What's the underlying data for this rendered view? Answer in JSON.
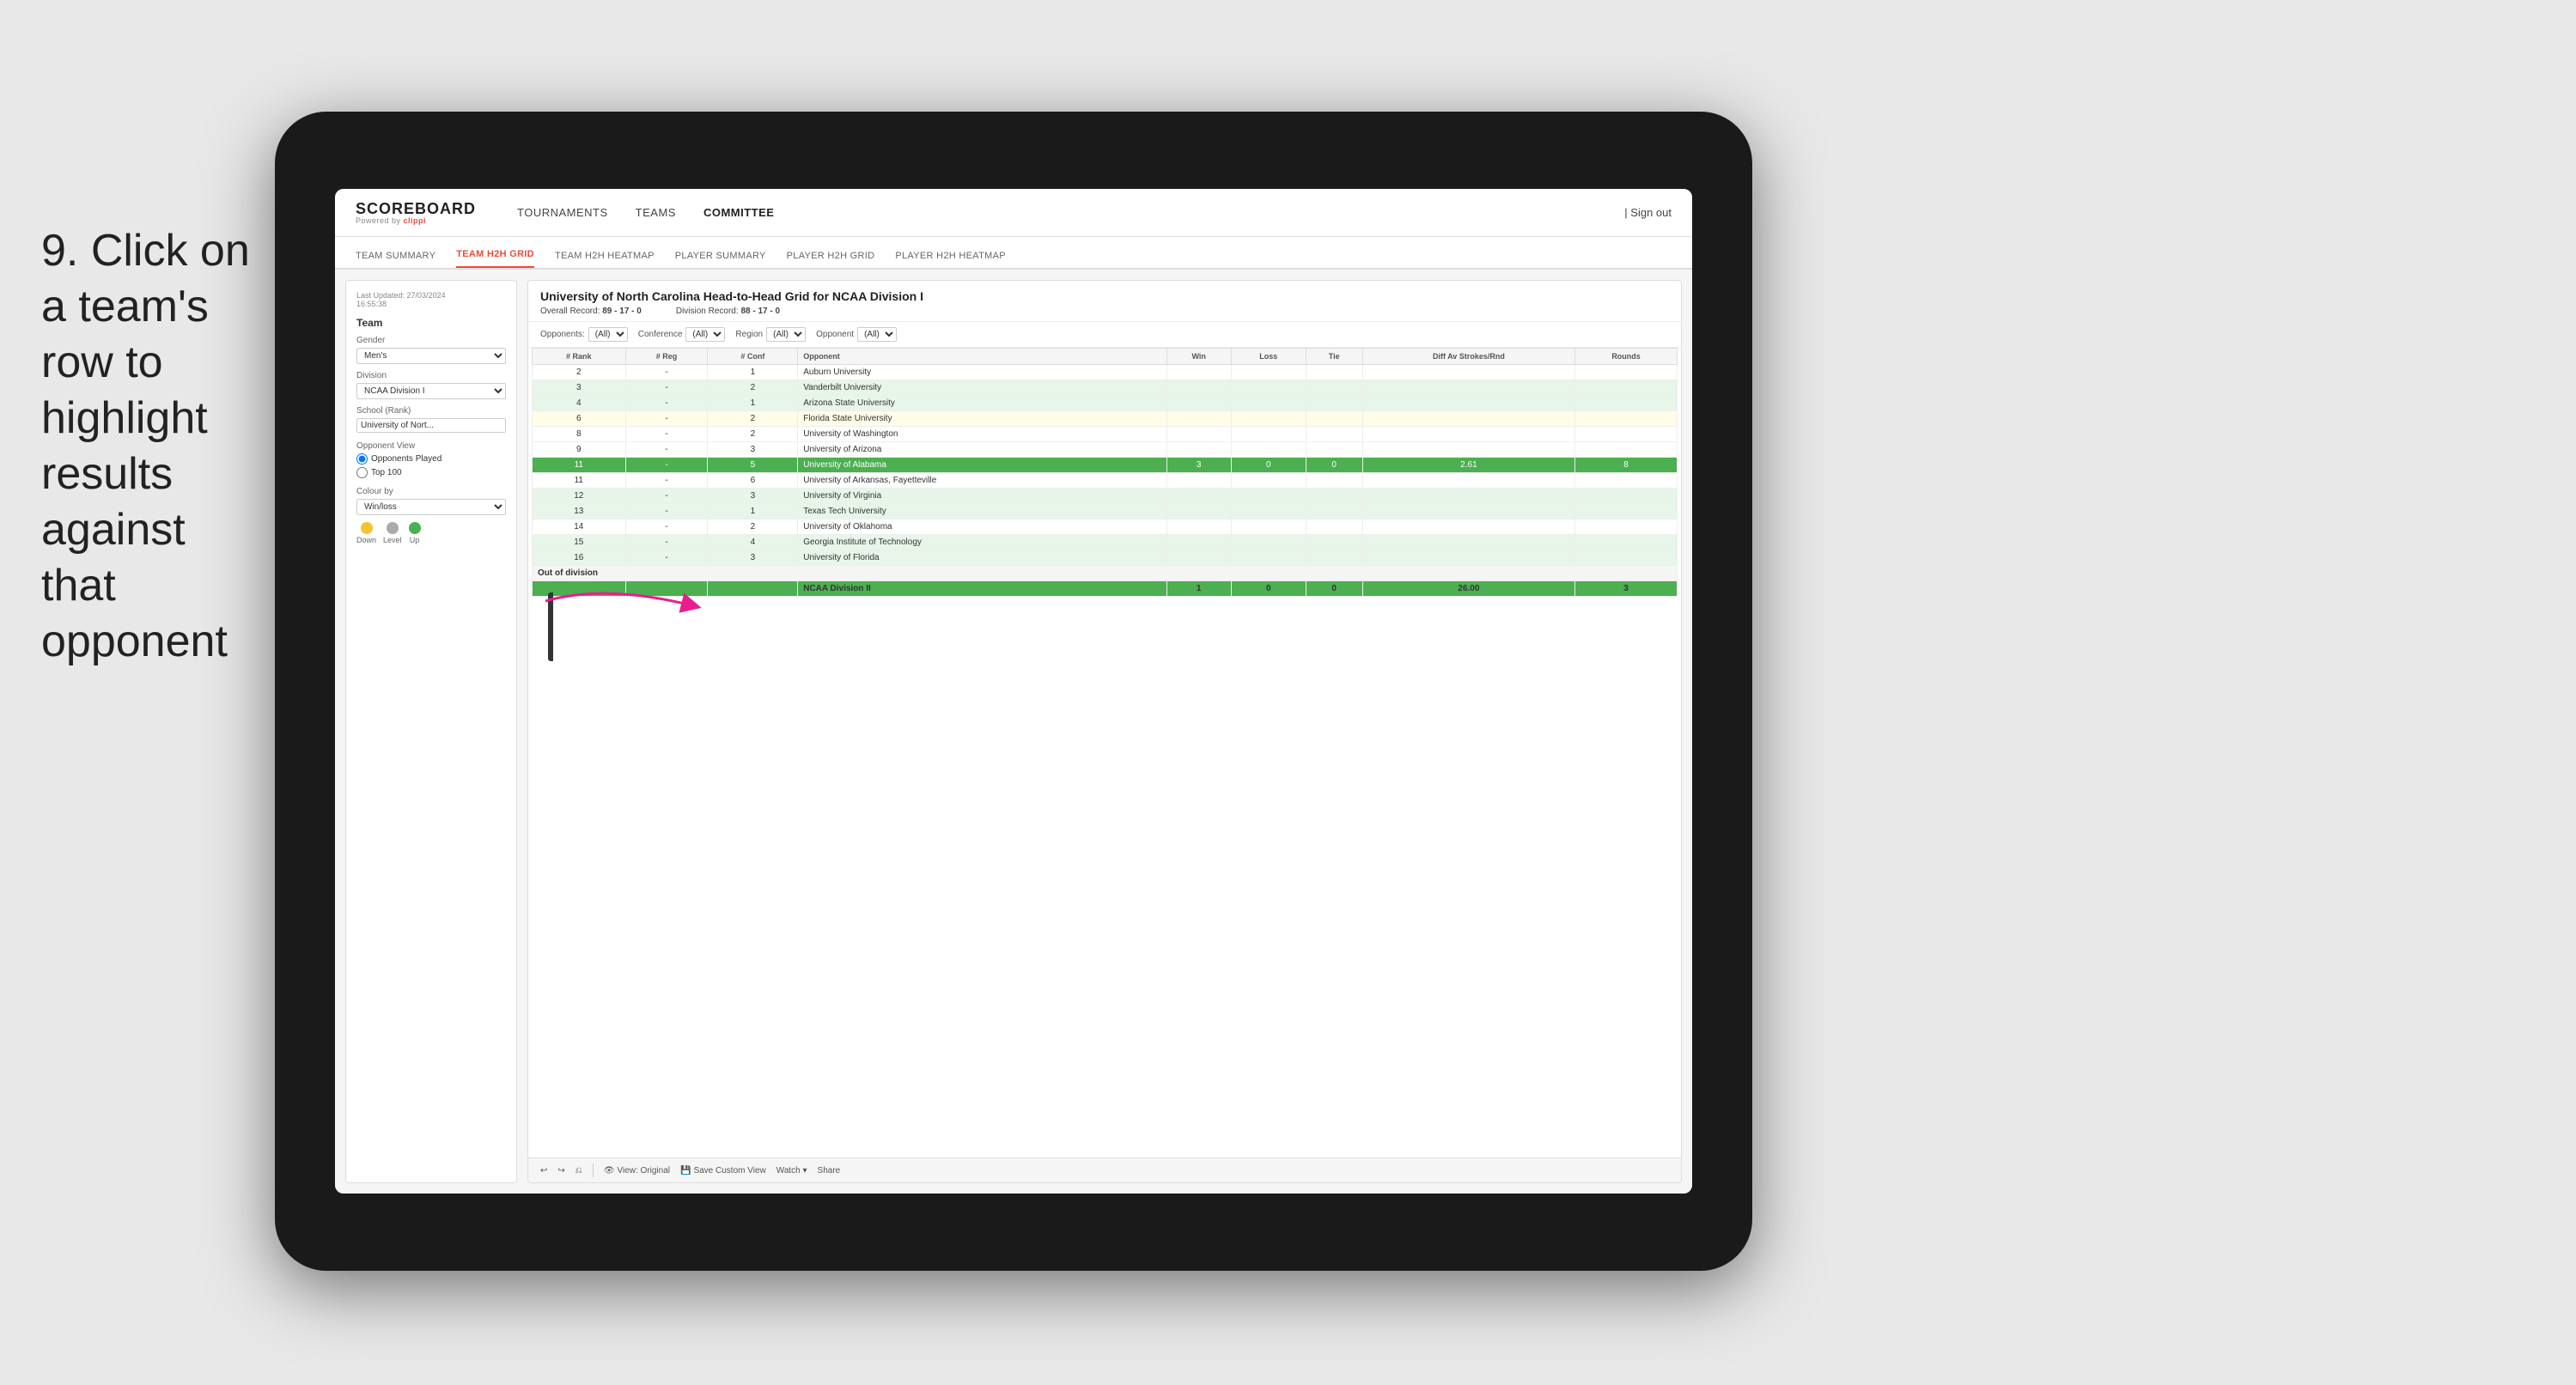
{
  "instruction": {
    "step": "9.",
    "text": "Click on a team's row to highlight results against that opponent"
  },
  "app": {
    "logo": "SCOREBOARD",
    "powered_by": "Powered by clippi",
    "nav": {
      "links": [
        "TOURNAMENTS",
        "TEAMS",
        "COMMITTEE"
      ],
      "sign_out": "Sign out"
    },
    "sub_nav": {
      "links": [
        "TEAM SUMMARY",
        "TEAM H2H GRID",
        "TEAM H2H HEATMAP",
        "PLAYER SUMMARY",
        "PLAYER H2H GRID",
        "PLAYER H2H HEATMAP"
      ],
      "active": "TEAM H2H GRID"
    }
  },
  "sidebar": {
    "last_updated_label": "Last Updated: 27/03/2024",
    "last_updated_time": "16:55:38",
    "team_section": "Team",
    "gender_label": "Gender",
    "gender_value": "Men's",
    "division_label": "Division",
    "division_value": "NCAA Division I",
    "school_label": "School (Rank)",
    "school_value": "University of Nort...",
    "opponent_view_title": "Opponent View",
    "radio1": "Opponents Played",
    "radio2": "Top 100",
    "colour_by_label": "Colour by",
    "colour_by_value": "Win/loss",
    "legend": [
      {
        "color": "#f4c430",
        "label": "Down"
      },
      {
        "color": "#aaaaaa",
        "label": "Level"
      },
      {
        "color": "#4CAF50",
        "label": "Up"
      }
    ]
  },
  "main_panel": {
    "title": "University of North Carolina Head-to-Head Grid for NCAA Division I",
    "overall_record_label": "Overall Record:",
    "overall_record": "89 - 17 - 0",
    "division_record_label": "Division Record:",
    "division_record": "88 - 17 - 0",
    "filters": {
      "opponents_label": "Opponents:",
      "opponents_value": "(All)",
      "conference_label": "Conference",
      "conference_value": "(All)",
      "region_label": "Region",
      "region_value": "(All)",
      "opponent_label": "Opponent",
      "opponent_value": "(All)"
    },
    "table_headers": [
      "# Rank",
      "# Reg",
      "# Conf",
      "Opponent",
      "Win",
      "Loss",
      "Tie",
      "Diff Av Strokes/Rnd",
      "Rounds"
    ],
    "rows": [
      {
        "rank": "2",
        "reg": "-",
        "conf": "1",
        "opponent": "Auburn University",
        "win": "",
        "loss": "",
        "tie": "",
        "diff": "",
        "rounds": "",
        "style": "normal"
      },
      {
        "rank": "3",
        "reg": "-",
        "conf": "2",
        "opponent": "Vanderbilt University",
        "win": "",
        "loss": "",
        "tie": "",
        "diff": "",
        "rounds": "",
        "style": "light-green"
      },
      {
        "rank": "4",
        "reg": "-",
        "conf": "1",
        "opponent": "Arizona State University",
        "win": "",
        "loss": "",
        "tie": "",
        "diff": "",
        "rounds": "",
        "style": "light-green"
      },
      {
        "rank": "6",
        "reg": "-",
        "conf": "2",
        "opponent": "Florida State University",
        "win": "",
        "loss": "",
        "tie": "",
        "diff": "",
        "rounds": "",
        "style": "light-yellow"
      },
      {
        "rank": "8",
        "reg": "-",
        "conf": "2",
        "opponent": "University of Washington",
        "win": "",
        "loss": "",
        "tie": "",
        "diff": "",
        "rounds": "",
        "style": "normal"
      },
      {
        "rank": "9",
        "reg": "-",
        "conf": "3",
        "opponent": "University of Arizona",
        "win": "",
        "loss": "",
        "tie": "",
        "diff": "",
        "rounds": "",
        "style": "normal"
      },
      {
        "rank": "11",
        "reg": "-",
        "conf": "5",
        "opponent": "University of Alabama",
        "win": "3",
        "loss": "0",
        "tie": "0",
        "diff": "2.61",
        "rounds": "8",
        "style": "highlighted"
      },
      {
        "rank": "11",
        "reg": "-",
        "conf": "6",
        "opponent": "University of Arkansas, Fayetteville",
        "win": "",
        "loss": "",
        "tie": "",
        "diff": "",
        "rounds": "",
        "style": "normal"
      },
      {
        "rank": "12",
        "reg": "-",
        "conf": "3",
        "opponent": "University of Virginia",
        "win": "",
        "loss": "",
        "tie": "",
        "diff": "",
        "rounds": "",
        "style": "light-green"
      },
      {
        "rank": "13",
        "reg": "-",
        "conf": "1",
        "opponent": "Texas Tech University",
        "win": "",
        "loss": "",
        "tie": "",
        "diff": "",
        "rounds": "",
        "style": "light-green"
      },
      {
        "rank": "14",
        "reg": "-",
        "conf": "2",
        "opponent": "University of Oklahoma",
        "win": "",
        "loss": "",
        "tie": "",
        "diff": "",
        "rounds": "",
        "style": "normal"
      },
      {
        "rank": "15",
        "reg": "-",
        "conf": "4",
        "opponent": "Georgia Institute of Technology",
        "win": "",
        "loss": "",
        "tie": "",
        "diff": "",
        "rounds": "",
        "style": "light-green"
      },
      {
        "rank": "16",
        "reg": "-",
        "conf": "3",
        "opponent": "University of Florida",
        "win": "",
        "loss": "",
        "tie": "",
        "diff": "",
        "rounds": "",
        "style": "light-green"
      }
    ],
    "out_of_division_section": "Out of division",
    "out_of_division_row": {
      "label": "NCAA Division II",
      "win": "1",
      "loss": "0",
      "tie": "0",
      "diff": "26.00",
      "rounds": "3"
    }
  },
  "toolbar": {
    "buttons": [
      "↩",
      "↪",
      "⎌",
      "⊞",
      "⊘",
      "⊕",
      "⊙"
    ],
    "view_label": "View: Original",
    "save_label": "Save Custom View",
    "watch_label": "Watch ▾",
    "share_label": "Share"
  }
}
